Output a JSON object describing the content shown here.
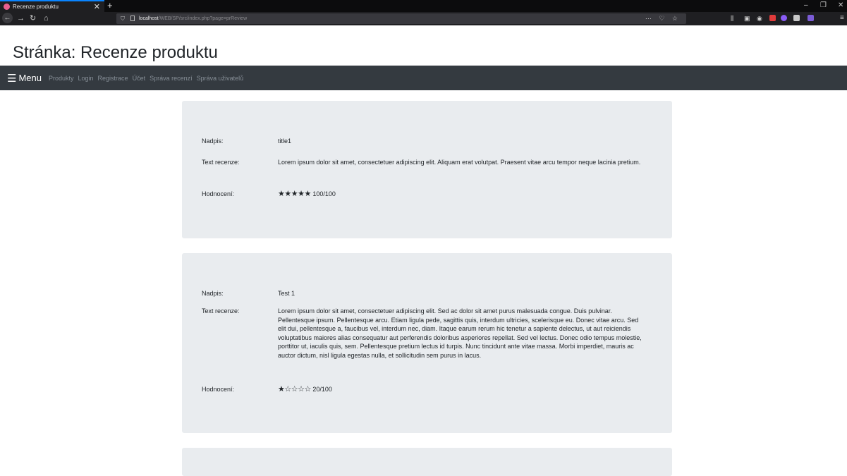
{
  "browser": {
    "tab_title": "Recenze produktu",
    "tab_close": "✕",
    "new_tab": "+",
    "url_host": "localhost",
    "url_path": "/WEB/SP/src/index.php?page=prReview",
    "url_actions": "⋯ ♡ ☆",
    "window_controls": {
      "minimize": "–",
      "maximize": "❐",
      "close": "✕"
    }
  },
  "page": {
    "title": "Stránka: Recenze produktu"
  },
  "nav": {
    "brand_icon": "☰",
    "brand": "Menu",
    "links": [
      "Produkty",
      "Login",
      "Registrace",
      "Účet",
      "Správa recenzí",
      "Správa uživatelů"
    ]
  },
  "labels": {
    "title": "Nadpis:",
    "text": "Text recenze:",
    "rating": "Hodnocení:"
  },
  "reviews": [
    {
      "title": "title1",
      "text": "Lorem ipsum dolor sit amet, consectetuer adipiscing elit. Aliquam erat volutpat. Praesent vitae arcu tempor neque lacinia pretium.",
      "stars": "★★★★★",
      "score": "100/100",
      "rating_stars": 5
    },
    {
      "title": "Test 1",
      "text": "Lorem ipsum dolor sit amet, consectetuer adipiscing elit. Sed ac dolor sit amet purus malesuada congue. Duis pulvinar. Pellentesque ipsum. Pellentesque arcu. Etiam ligula pede, sagittis quis, interdum ultricies, scelerisque eu. Donec vitae arcu. Sed elit dui, pellentesque a, faucibus vel, interdum nec, diam. Itaque earum rerum hic tenetur a sapiente delectus, ut aut reiciendis voluptatibus maiores alias consequatur aut perferendis doloribus asperiores repellat. Sed vel lectus. Donec odio tempus molestie, porttitor ut, iaculis quis, sem. Pellentesque pretium lectus id turpis. Nunc tincidunt ante vitae massa. Morbi imperdiet, mauris ac auctor dictum, nisl ligula egestas nulla, et sollicitudin sem purus in lacus.",
      "stars": "★☆☆☆☆",
      "score": "20/100",
      "rating_stars": 1
    }
  ],
  "colors": {
    "navbar_bg": "#343a40",
    "card_bg": "#e9ecef",
    "nav_link": "#868e96",
    "tab_accent": "#0a84ff"
  }
}
